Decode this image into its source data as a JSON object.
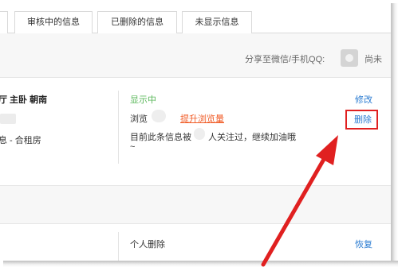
{
  "tabs": [
    {
      "label": ""
    },
    {
      "label": "审核中的信息"
    },
    {
      "label": "已删除的信息"
    },
    {
      "label": "未显示信息"
    }
  ],
  "share": {
    "label": "分享至微信/手机QQ:",
    "trailing_text": "尚未"
  },
  "listing": {
    "title": "厅 主卧 朝南",
    "type_text": "息 - 合租房",
    "status": "显示中",
    "views_label": "浏览",
    "boost_link": "提升浏览量",
    "follow_text_before": "目前此条信息被",
    "follow_text_after": "人关注过，继续加油哦",
    "follow_tail": "~",
    "edit_label": "修改",
    "delete_label": "删除"
  },
  "listing2": {
    "status": "个人删除",
    "restore_label": "恢复"
  },
  "colors": {
    "status_green": "#5cb85c",
    "link_blue": "#2a7bd1",
    "boost_orange": "#f05a24",
    "highlight_red": "#e02020"
  }
}
